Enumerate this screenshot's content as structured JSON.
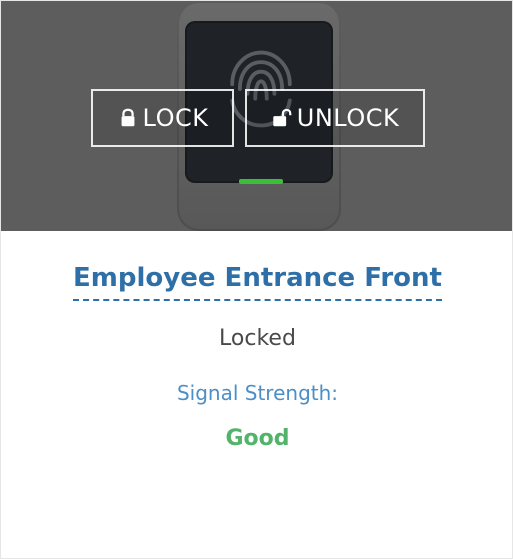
{
  "actions": {
    "lock_label": "LOCK",
    "unlock_label": "UNLOCK",
    "lock_icon": "lock-icon",
    "unlock_icon": "unlock-icon"
  },
  "door": {
    "name": "Employee Entrance Front",
    "status": "Locked",
    "signal_label": "Signal Strength:",
    "signal_value": "Good"
  },
  "colors": {
    "title_blue": "#2f6fa8",
    "signal_blue": "#4b8fc7",
    "good_green": "#52b36a",
    "device_indicator": "#3bbf3b",
    "overlay_gray": "#5d5d5d"
  }
}
